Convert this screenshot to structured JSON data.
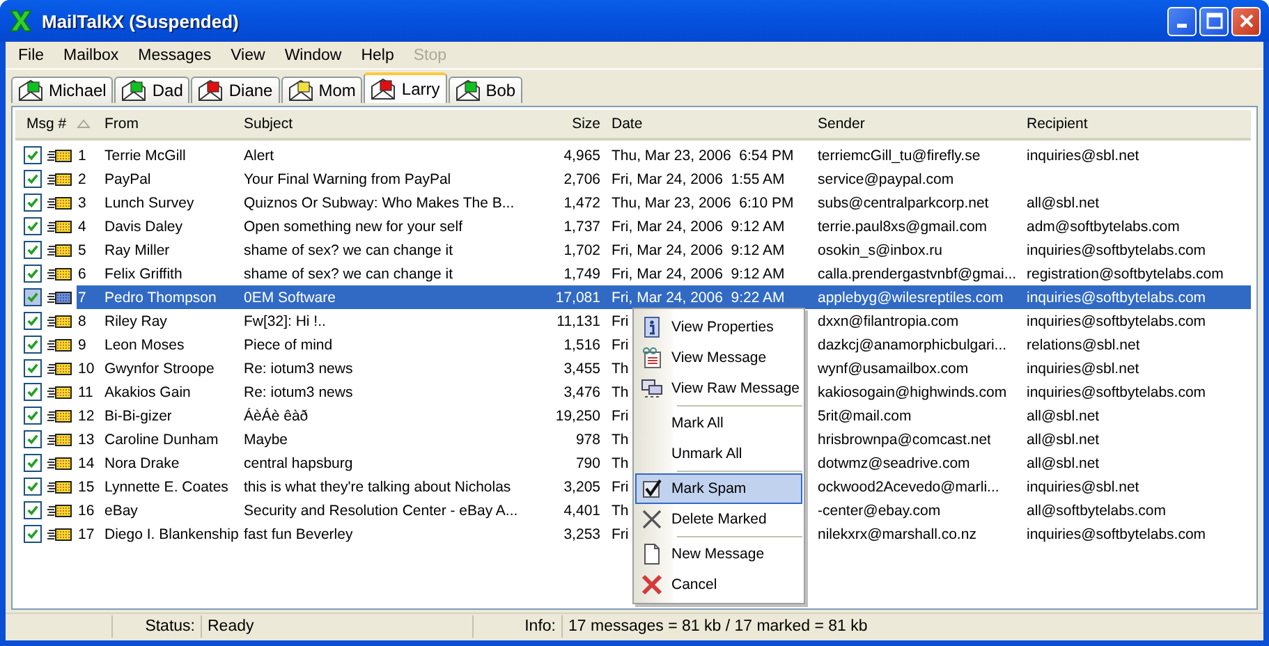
{
  "window": {
    "title": "MailTalkX (Suspended)"
  },
  "menu": [
    {
      "label": "File",
      "disabled": false
    },
    {
      "label": "Mailbox",
      "disabled": false
    },
    {
      "label": "Messages",
      "disabled": false
    },
    {
      "label": "View",
      "disabled": false
    },
    {
      "label": "Window",
      "disabled": false
    },
    {
      "label": "Help",
      "disabled": false
    },
    {
      "label": "Stop",
      "disabled": true
    }
  ],
  "tabs": [
    {
      "label": "Michael",
      "selected": false,
      "color": "#10c020"
    },
    {
      "label": "Dad",
      "selected": false,
      "color": "#10c020"
    },
    {
      "label": "Diane",
      "selected": false,
      "color": "#e01010"
    },
    {
      "label": "Mom",
      "selected": false,
      "color": "#f0e040"
    },
    {
      "label": "Larry",
      "selected": true,
      "color": "#e01010"
    },
    {
      "label": "Bob",
      "selected": false,
      "color": "#10c020"
    }
  ],
  "table": {
    "columns": [
      "Msg #",
      "From",
      "Subject",
      "Size",
      "Date",
      "Sender",
      "Recipient"
    ],
    "rows": [
      {
        "num": "1",
        "from": "Terrie McGill",
        "subject": "Alert",
        "size": "4,965",
        "date": "Thu, Mar 23, 2006  6:54 PM",
        "sender": "terriemcGill_tu@firefly.se",
        "recipient": "inquiries@sbl.net",
        "checked": true,
        "selected": false
      },
      {
        "num": "2",
        "from": "PayPal",
        "subject": "Your Final Warning from PayPal",
        "size": "2,706",
        "date": "Fri, Mar 24, 2006  1:55 AM",
        "sender": "service@paypal.com",
        "checked": true,
        "selected": false
      },
      {
        "num": "3",
        "from": "Lunch Survey",
        "subject": "Quiznos Or Subway: Who Makes The B...",
        "size": "1,472",
        "date": "Thu, Mar 23, 2006  6:10 PM",
        "sender": "subs@centralparkcorp.net",
        "recipient": "all@sbl.net",
        "checked": true,
        "selected": false
      },
      {
        "num": "4",
        "from": "Davis Daley",
        "subject": "Open something new for your self",
        "size": "1,737",
        "date": "Fri, Mar 24, 2006  9:12 AM",
        "sender": "terrie.paul8xs@gmail.com",
        "recipient": "adm@softbytelabs.com",
        "checked": true,
        "selected": false
      },
      {
        "num": "5",
        "from": "Ray Miller",
        "subject": "shame of sex? we can change it",
        "size": "1,702",
        "date": "Fri, Mar 24, 2006  9:12 AM",
        "sender": "osokin_s@inbox.ru",
        "recipient": "inquiries@softbytelabs.com",
        "checked": true,
        "selected": false
      },
      {
        "num": "6",
        "from": "Felix Griffith",
        "subject": "shame of sex? we can change it",
        "size": "1,749",
        "date": "Fri, Mar 24, 2006  9:12 AM",
        "sender": "calla.prendergastvnbf@gmai...",
        "recipient": "registration@softbytelabs.com",
        "checked": true,
        "selected": false
      },
      {
        "num": "7",
        "from": "Pedro Thompson",
        "subject": "0EM Software",
        "size": "17,081",
        "date": "Fri, Mar 24, 2006  9:22 AM",
        "sender": "applebyg@wilesreptiles.com",
        "recipient": "inquiries@softbytelabs.com",
        "checked": true,
        "selected": true
      },
      {
        "num": "8",
        "from": "Riley Ray",
        "subject": "Fw[32]: Hi !..",
        "size": "11,131",
        "date": "Fri",
        "sender": "dxxn@filantropia.com",
        "recipient": "inquiries@softbytelabs.com",
        "checked": true,
        "selected": false
      },
      {
        "num": "9",
        "from": "Leon Moses",
        "subject": "Piece of mind",
        "size": "1,516",
        "date": "Fri",
        "sender": "dazkcj@anamorphicbulgari...",
        "recipient": "relations@sbl.net",
        "checked": true,
        "selected": false
      },
      {
        "num": "10",
        "from": "Gwynfor Stroope",
        "subject": "Re: iotum3 news",
        "size": "3,455",
        "date": "Th",
        "sender": "wynf@usamailbox.com",
        "recipient": "inquiries@sbl.net",
        "checked": true,
        "selected": false
      },
      {
        "num": "11",
        "from": "Akakios Gain",
        "subject": "Re: iotum3 news",
        "size": "3,476",
        "date": "Th",
        "sender": "kakiosogain@highwinds.com",
        "recipient": "inquiries@softbytelabs.com",
        "checked": true,
        "selected": false
      },
      {
        "num": "12",
        "from": "Bi-Bi-gizer",
        "subject": "ÁèÁè êàð",
        "size": "19,250",
        "date": "Fri",
        "sender": "5rit@mail.com",
        "recipient": "all@sbl.net",
        "checked": true,
        "selected": false
      },
      {
        "num": "13",
        "from": "Caroline Dunham",
        "subject": "Maybe",
        "size": "978",
        "date": "Th",
        "sender": "hrisbrownpa@comcast.net",
        "recipient": "all@sbl.net",
        "checked": true,
        "selected": false
      },
      {
        "num": "14",
        "from": "Nora Drake",
        "subject": "central hapsburg",
        "size": "790",
        "date": "Th",
        "sender": "dotwmz@seadrive.com",
        "recipient": "all@sbl.net",
        "checked": true,
        "selected": false
      },
      {
        "num": "15",
        "from": "Lynnette E. Coates",
        "subject": "this is what they're talking about Nicholas",
        "size": "3,205",
        "date": "Fri",
        "sender": "ockwood2Acevedo@marli...",
        "recipient": "inquiries@sbl.net",
        "checked": true,
        "selected": false
      },
      {
        "num": "16",
        "from": "eBay",
        "subject": "Security and Resolution Center - eBay A...",
        "size": "4,401",
        "date": "Th",
        "sender": "-center@ebay.com",
        "recipient": "all@softbytelabs.com",
        "checked": true,
        "selected": false
      },
      {
        "num": "17",
        "from": "Diego I. Blankenship",
        "subject": "fast fun Beverley",
        "size": "3,253",
        "date": "Fri",
        "sender": "nilekxrx@marshall.co.nz",
        "recipient": "inquiries@softbytelabs.com",
        "checked": true,
        "selected": false
      }
    ]
  },
  "context_menu": {
    "items": [
      {
        "kind": "item",
        "label": "View Properties",
        "selected": false
      },
      {
        "kind": "item",
        "label": "View Message",
        "selected": false
      },
      {
        "kind": "item",
        "label": "View Raw Message",
        "selected": false
      },
      {
        "kind": "separator"
      },
      {
        "kind": "item",
        "label": "Mark All",
        "selected": false
      },
      {
        "kind": "item",
        "label": "Unmark All",
        "selected": false
      },
      {
        "kind": "separator"
      },
      {
        "kind": "item",
        "label": "Mark Spam",
        "selected": true
      },
      {
        "kind": "item",
        "label": "Delete Marked",
        "selected": false
      },
      {
        "kind": "separator"
      },
      {
        "kind": "item",
        "label": "New Message",
        "selected": false
      },
      {
        "kind": "item",
        "label": "Cancel",
        "selected": false
      }
    ]
  },
  "status_bar": {
    "status_label": "Status:",
    "status": "Ready",
    "info_label": "Info:",
    "info": "17 messages = 81 kb / 17 marked = 81 kb"
  }
}
